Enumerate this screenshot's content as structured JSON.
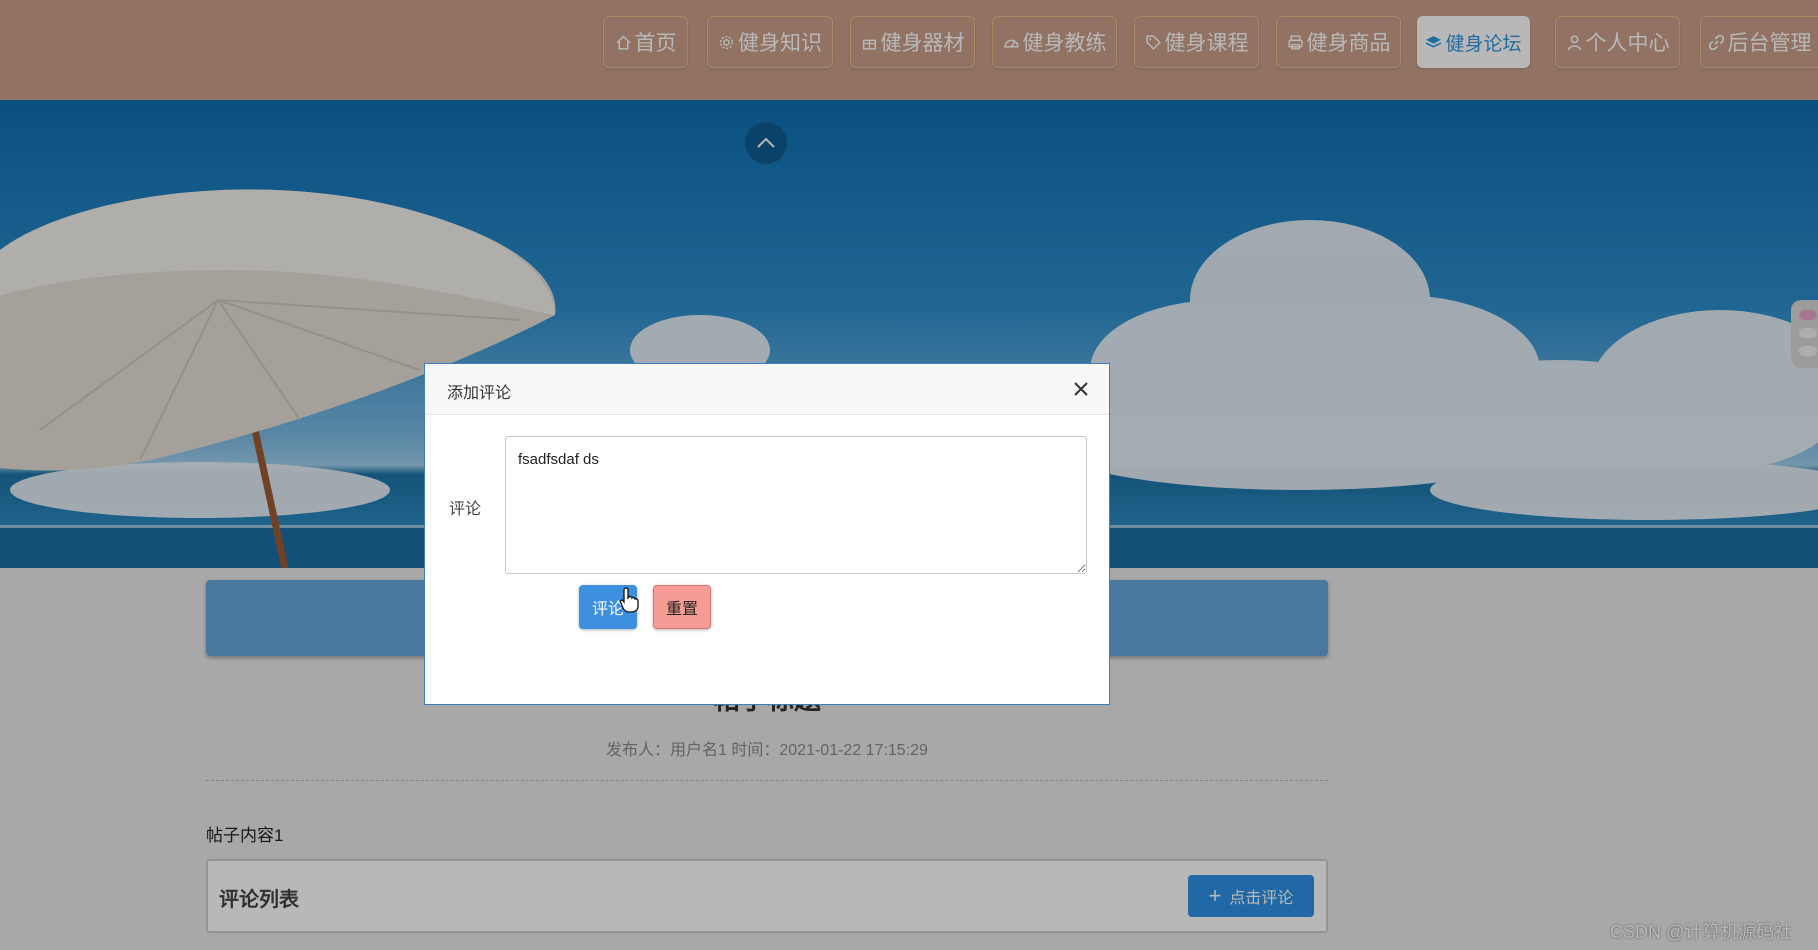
{
  "nav": {
    "items": [
      {
        "label": "首页",
        "icon": "home-icon"
      },
      {
        "label": "健身知识",
        "icon": "gear-icon"
      },
      {
        "label": "健身器材",
        "icon": "gift-icon"
      },
      {
        "label": "健身教练",
        "icon": "gauge-icon"
      },
      {
        "label": "健身课程",
        "icon": "tag-icon"
      },
      {
        "label": "健身商品",
        "icon": "printer-icon"
      },
      {
        "label": "健身论坛",
        "icon": "layers-icon",
        "active": true
      },
      {
        "label": "个人中心",
        "icon": "user-icon"
      },
      {
        "label": "后台管理",
        "icon": "link-icon"
      }
    ],
    "active_color": "#2c97de",
    "bar_color": "#c99e8a"
  },
  "post": {
    "title": "帖子标题",
    "meta": "发布人：用户名1 时间：2021-01-22 17:15:29",
    "body": "帖子内容1"
  },
  "comments": {
    "title": "评论列表",
    "add_button": "点击评论"
  },
  "dialog": {
    "title": "添加评论",
    "field_label": "评论",
    "comment_value": "fsadfsdaf ds",
    "submit_label": "评论",
    "reset_label": "重置"
  },
  "watermark": "CSDN @计算机源码社"
}
